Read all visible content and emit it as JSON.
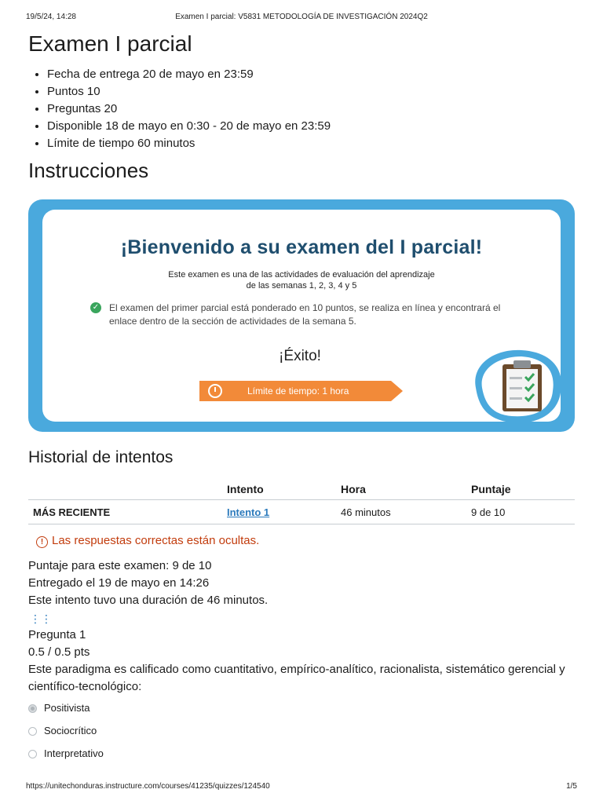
{
  "print_header": {
    "date": "19/5/24, 14:28",
    "title": "Examen I parcial: V5831 METODOLOGÍA DE INVESTIGACIÓN 2024Q2"
  },
  "page_title": "Examen I parcial",
  "details": [
    "Fecha de entrega 20 de mayo en 23:59",
    "Puntos 10",
    "Preguntas 20",
    "Disponible 18 de mayo en 0:30 - 20 de mayo en 23:59",
    "Límite de tiempo 60 minutos"
  ],
  "instructions_heading": "Instrucciones",
  "banner": {
    "title": "¡Bienvenido a su examen del I parcial!",
    "subtitle_line1": "Este examen es una de las actividades de evaluación del aprendizaje",
    "subtitle_line2": "de las semanas 1, 2, 3, 4 y 5",
    "info_text": "El examen del primer parcial está ponderado en 10 puntos, se realiza en línea y encontrará el enlace dentro de la sección de actividades de la semana 5.",
    "exito": "¡Éxito!",
    "time_limit": "Límite de tiempo: 1 hora",
    "colors": {
      "frame": "#4aa9dd",
      "title": "#1f4e6e",
      "timer": "#f28a39",
      "check": "#3aa55d"
    },
    "icons": [
      "check-circle-icon",
      "stopwatch-icon",
      "clipboard-checklist-icon"
    ]
  },
  "history": {
    "heading": "Historial de intentos",
    "columns": [
      "",
      "Intento",
      "Hora",
      "Puntaje"
    ],
    "rows": [
      {
        "status": "MÁS RECIENTE",
        "attempt": "Intento 1",
        "time": "46 minutos",
        "score": "9 de 10"
      }
    ]
  },
  "hidden_note": "Las respuestas correctas están ocultas.",
  "summary": {
    "score": "Puntaje para este examen: 9 de 10",
    "submitted": "Entregado el 19 de mayo en 14:26",
    "duration": "Este intento tuvo una duración de 46 minutos."
  },
  "question": {
    "title": "Pregunta 1",
    "points": "0.5 / 0.5 pts",
    "text": "Este paradigma es calificado como cuantitativo, empírico-analítico, racionalista, sistemático gerencial y científico-tecnológico:",
    "options": [
      {
        "label": "Positivista",
        "selected": true
      },
      {
        "label": "Sociocrítico",
        "selected": false
      },
      {
        "label": "Interpretativo",
        "selected": false
      }
    ]
  },
  "print_footer": {
    "url": "https://unitechonduras.instructure.com/courses/41235/quizzes/124540",
    "page": "1/5"
  }
}
